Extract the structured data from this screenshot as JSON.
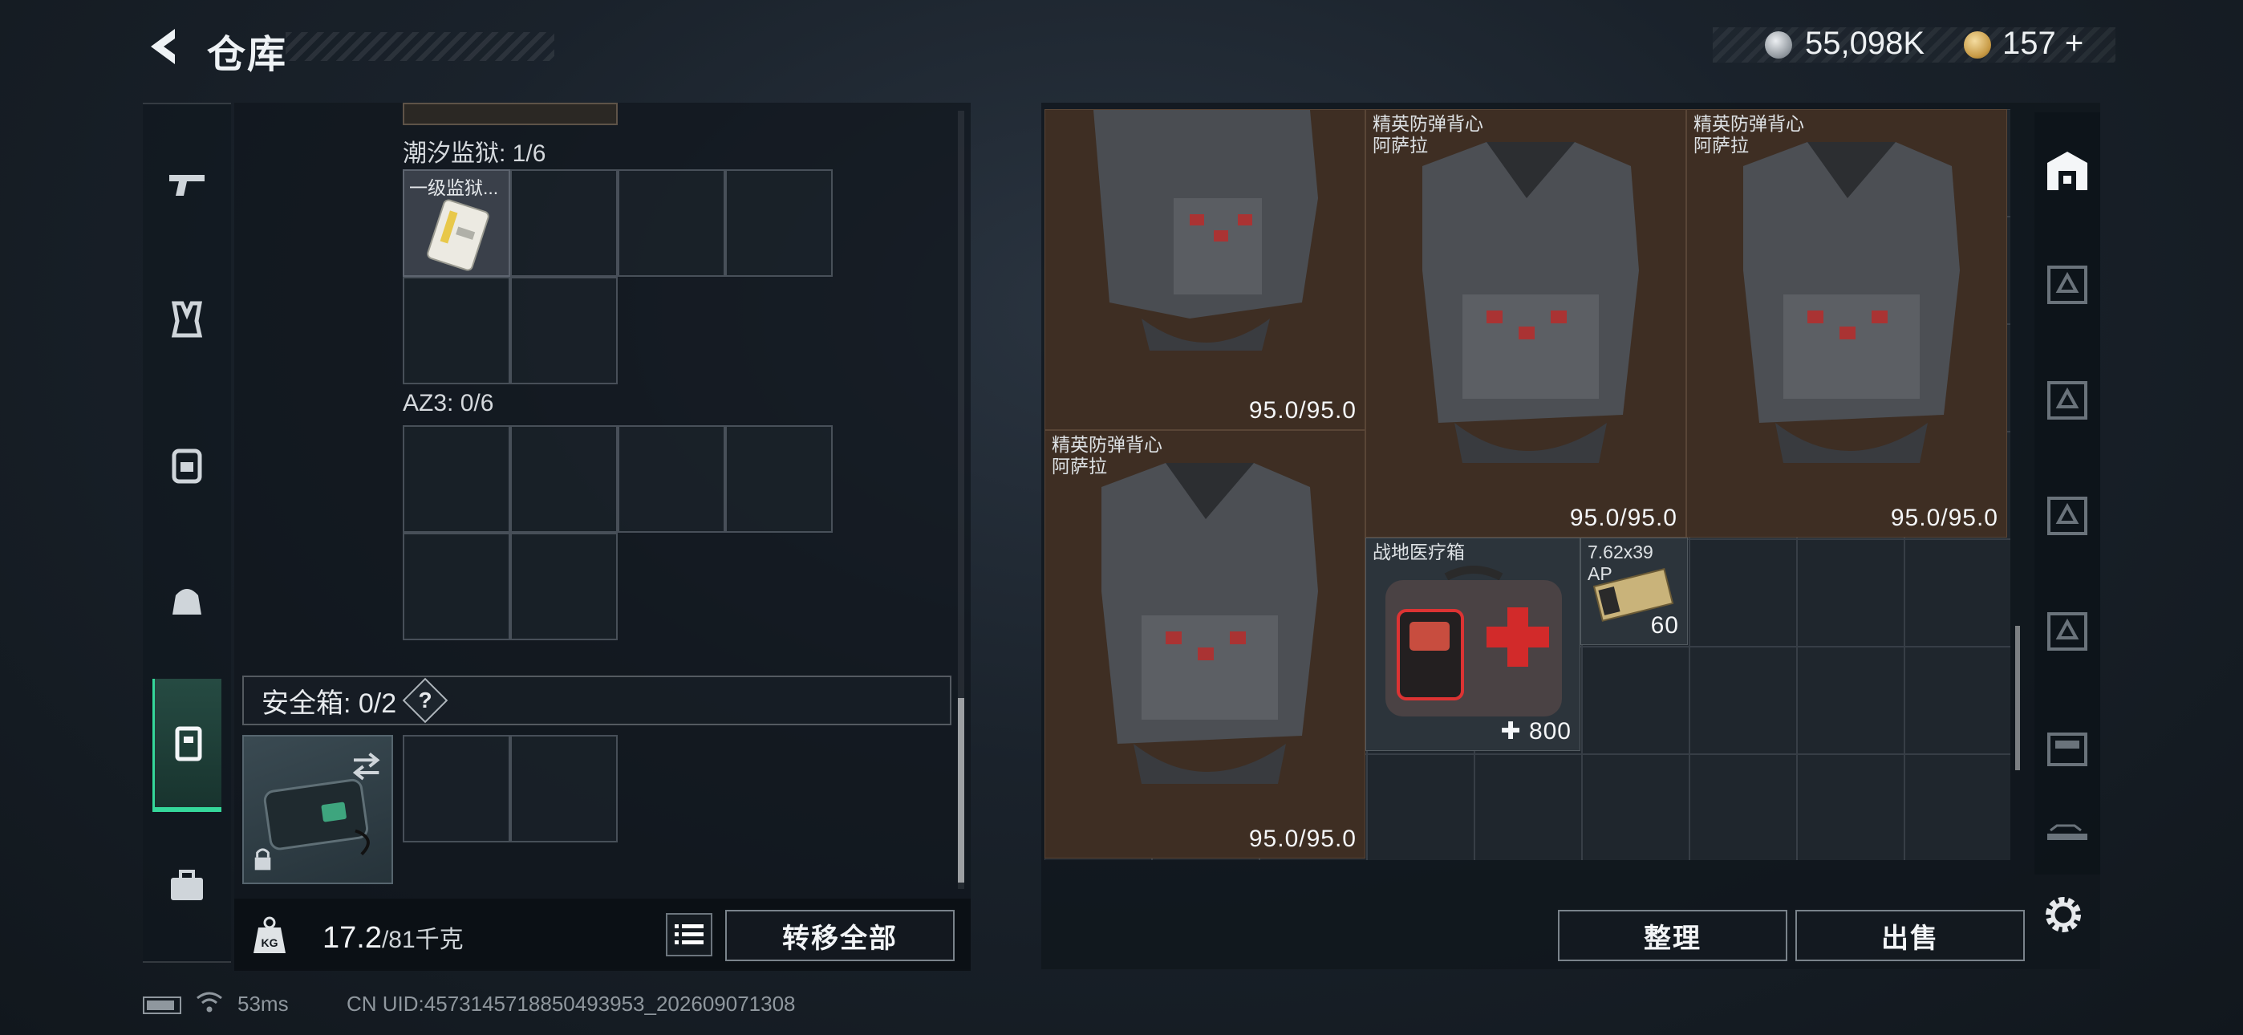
{
  "header": {
    "title": "仓库",
    "currency_silver": "55,098K",
    "currency_gold": "157",
    "currency_add": "+"
  },
  "nav": {
    "items": [
      "weapon-icon",
      "chest-rig-icon",
      "backpack-icon",
      "bag-icon",
      "case-icon",
      "toolbox-icon"
    ],
    "active": "case-icon"
  },
  "left": {
    "section1_label": "潮汐监狱: 1/6",
    "section1_item_label": "一级监狱...",
    "section2_label": "AZ3: 0/6",
    "safe_label": "安全箱: 0/2",
    "help": "?",
    "weight_value": "17.2",
    "weight_max": "/81千克",
    "transfer_all": "转移全部"
  },
  "stash": {
    "items": [
      {
        "name1": "",
        "name2": "",
        "value": "95.0/95.0"
      },
      {
        "name1": "精英防弹背心",
        "name2": "阿萨拉",
        "value": "95.0/95.0"
      },
      {
        "name1": "精英防弹背心",
        "name2": "阿萨拉",
        "value": "95.0/95.0"
      },
      {
        "name1": "精英防弹背心",
        "name2": "阿萨拉",
        "value": "95.0/95.0"
      },
      {
        "name1": "战地医疗箱",
        "value": "800",
        "plus": "✚"
      },
      {
        "name1": "7.62x39",
        "name2": "AP",
        "value": "60"
      }
    ],
    "sort_button": "整理",
    "sell_button": "出售"
  },
  "side_tabs": [
    "stash-main-icon",
    "tier3-case-icon",
    "tier3-case-icon",
    "tier3-case-icon",
    "tier3-case-icon",
    "tier4-case-icon",
    "tier3-weapon-case-icon"
  ],
  "status": {
    "ping": "53ms",
    "uid": "CN UID:4573145718850493953_202609071308"
  }
}
